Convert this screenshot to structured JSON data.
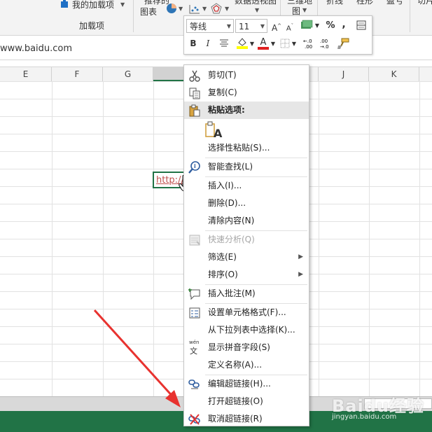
{
  "ribbon": {
    "my_addins": "我的加载项",
    "addins_group": "加载项",
    "recommended_charts_top": "推荐的",
    "recommended_charts": "图表",
    "pivot_chart": "数据透视图",
    "map_3d_top": "三维地",
    "map_3d": "图",
    "line": "折线",
    "column": "柱形",
    "winloss": "盈亏",
    "slicer": "切片"
  },
  "address": {
    "text": "www.baidu.com"
  },
  "grid": {
    "columns": [
      "E",
      "F",
      "G",
      "",
      "",
      "J",
      "K"
    ],
    "active_cell_text": "http://"
  },
  "minitoolbar": {
    "font_name": "等线",
    "font_size": "11",
    "grow_font": "A",
    "shrink_font": "A",
    "percent": "%",
    "comma": ",",
    "bold": "B",
    "italic": "I",
    "font_color_letter": "A",
    "dec_inc": "←.0\n.00",
    "dec_dec": ".00\n→.0"
  },
  "menu": {
    "items": [
      {
        "label": "剪切(T)",
        "icon": "scissors-icon"
      },
      {
        "label": "复制(C)",
        "icon": "copy-icon"
      },
      {
        "label": "粘贴选项:",
        "icon": "paste-icon"
      },
      {
        "label": "",
        "icon": "paste-text-only-icon"
      },
      {
        "label": "选择性粘贴(S)...",
        "icon": ""
      },
      {
        "label": "智能查找(L)",
        "icon": "smart-lookup-icon"
      },
      {
        "label": "插入(I)...",
        "icon": ""
      },
      {
        "label": "删除(D)...",
        "icon": ""
      },
      {
        "label": "清除内容(N)",
        "icon": ""
      },
      {
        "label": "快速分析(Q)",
        "icon": "quick-analysis-icon"
      },
      {
        "label": "筛选(E)",
        "icon": ""
      },
      {
        "label": "排序(O)",
        "icon": ""
      },
      {
        "label": "插入批注(M)",
        "icon": "insert-comment-icon"
      },
      {
        "label": "设置单元格格式(F)...",
        "icon": "format-cells-icon"
      },
      {
        "label": "从下拉列表中选择(K)...",
        "icon": ""
      },
      {
        "label": "显示拼音字段(S)",
        "icon": "phonetic-icon"
      },
      {
        "label": "定义名称(A)...",
        "icon": ""
      },
      {
        "label": "编辑超链接(H)...",
        "icon": "edit-hyperlink-icon"
      },
      {
        "label": "打开超链接(O)",
        "icon": ""
      },
      {
        "label": "取消超链接(R)",
        "icon": "remove-hyperlink-icon"
      }
    ],
    "phonetic_glyph_top": "wén",
    "phonetic_glyph": "文",
    "paste_glyph": "A"
  },
  "watermark": {
    "brand": "Baidu经验",
    "url": "jingyan.baidu.com"
  },
  "colors": {
    "excel_green": "#217346",
    "arrow_red": "#e8322f",
    "link_red": "#c0504d"
  }
}
